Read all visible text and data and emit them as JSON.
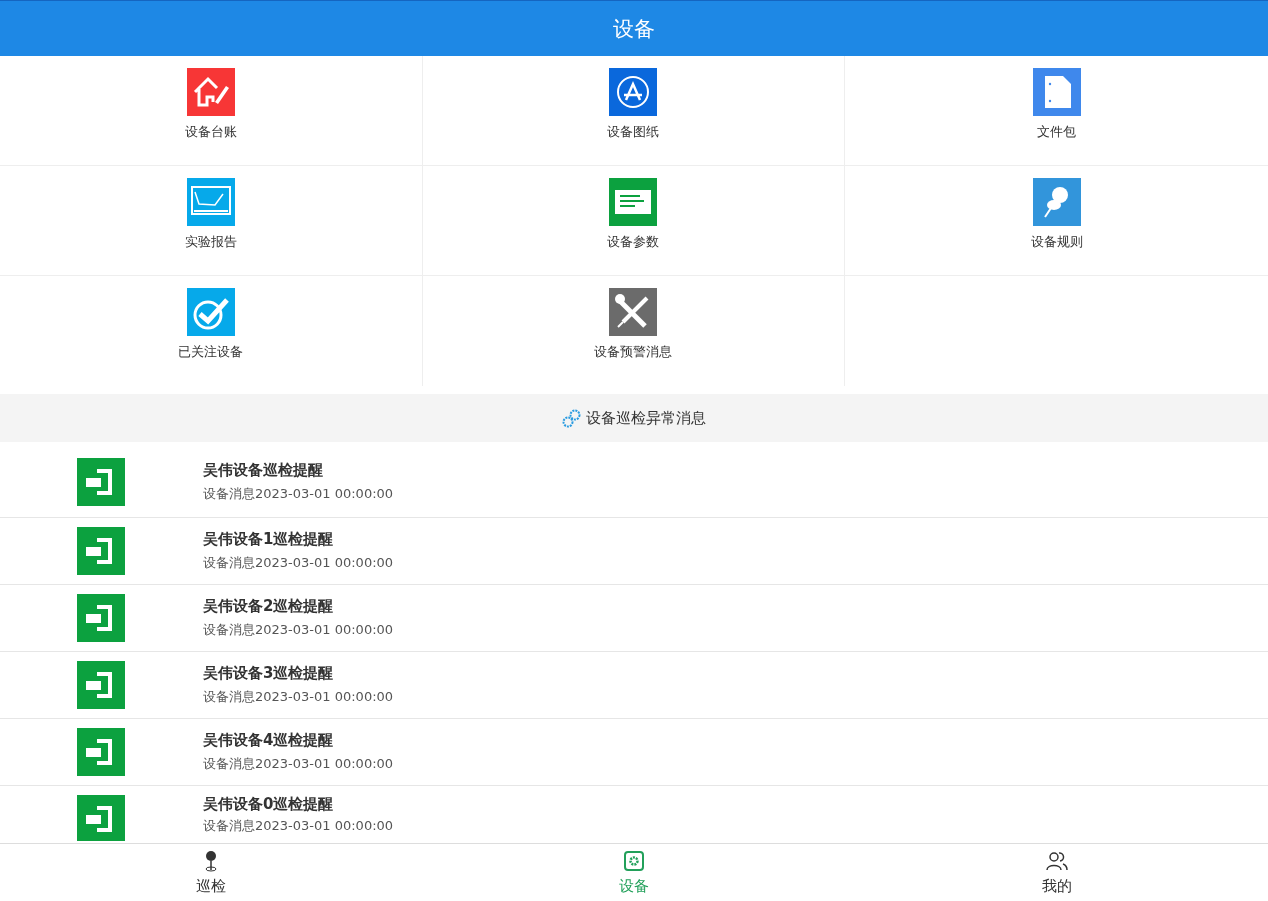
{
  "header": {
    "title": "设备"
  },
  "menu": [
    {
      "label": "设备台账",
      "kind": "house",
      "color": "#f73636"
    },
    {
      "label": "设备图纸",
      "kind": "appstore",
      "color": "#0a68dc"
    },
    {
      "label": "文件包",
      "kind": "file",
      "color": "#3f88ec"
    },
    {
      "label": "实验报告",
      "kind": "screen",
      "color": "#06a9ea"
    },
    {
      "label": "设备参数",
      "kind": "card",
      "color": "#0ca13f"
    },
    {
      "label": "设备规则",
      "kind": "pin",
      "color": "#3295db"
    },
    {
      "label": "已关注设备",
      "kind": "check",
      "color": "#06a9ea"
    },
    {
      "label": "设备预警消息",
      "kind": "tools",
      "color": "#6b6b6b"
    }
  ],
  "section": {
    "title": "设备巡检异常消息"
  },
  "messages": [
    {
      "title": "吴伟设备巡检提醒",
      "subtitle": "设备消息2023-03-01 00:00:00"
    },
    {
      "title": "吴伟设备1巡检提醒",
      "subtitle": "设备消息2023-03-01 00:00:00"
    },
    {
      "title": "吴伟设备2巡检提醒",
      "subtitle": "设备消息2023-03-01 00:00:00"
    },
    {
      "title": "吴伟设备3巡检提醒",
      "subtitle": "设备消息2023-03-01 00:00:00"
    },
    {
      "title": "吴伟设备4巡检提醒",
      "subtitle": "设备消息2023-03-01 00:00:00"
    },
    {
      "title": "吴伟设备0巡检提醒",
      "subtitle": "设备消息2023-03-01 00:00:00"
    }
  ],
  "tabs": [
    {
      "label": "巡检",
      "kind": "pin",
      "selected": false
    },
    {
      "label": "设备",
      "kind": "gear",
      "selected": true
    },
    {
      "label": "我的",
      "kind": "users",
      "selected": false
    }
  ]
}
